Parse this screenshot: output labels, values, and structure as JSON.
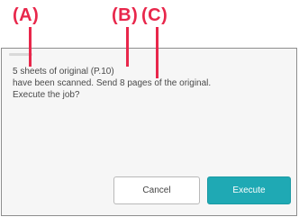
{
  "callouts": {
    "a": "(A)",
    "b": "(B)",
    "c": "(C)"
  },
  "dialog": {
    "message": "5 sheets of original (P.10)\nhave been scanned. Send 8 pages of the original.\nExecute the job?",
    "cancel_label": "Cancel",
    "execute_label": "Execute"
  },
  "colors": {
    "callout": "#e8274b",
    "execute_button": "#1fa9b4",
    "dialog_background": "#f6f6f6"
  }
}
